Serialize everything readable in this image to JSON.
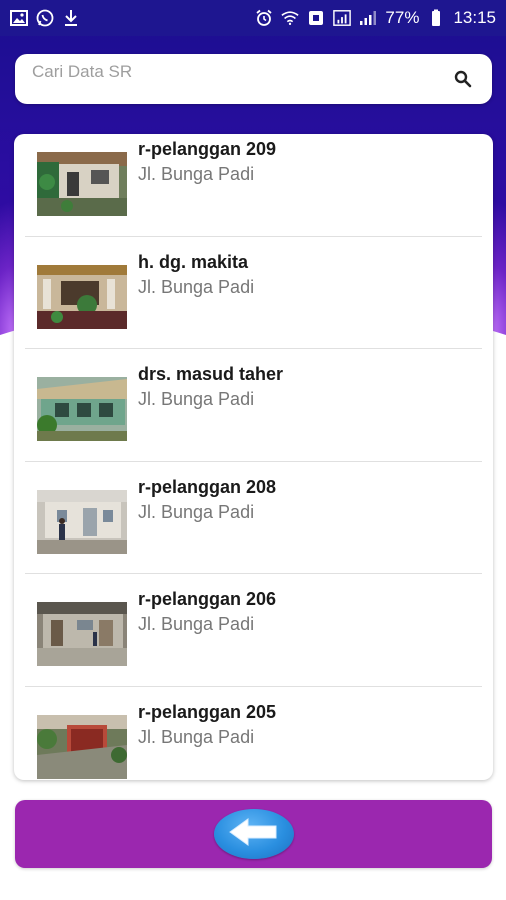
{
  "status_bar": {
    "battery": "77%",
    "time": "13:15"
  },
  "search": {
    "placeholder": "Cari Data SR",
    "value": ""
  },
  "list": {
    "items": [
      {
        "name": "r-pelanggan 209",
        "address": "Jl. Bunga Padi"
      },
      {
        "name": "h. dg. makita",
        "address": "Jl. Bunga Padi"
      },
      {
        "name": "drs. masud taher",
        "address": "Jl. Bunga Padi"
      },
      {
        "name": "r-pelanggan 208",
        "address": "Jl. Bunga Padi"
      },
      {
        "name": "r-pelanggan 206",
        "address": "Jl. Bunga Padi"
      },
      {
        "name": "r-pelanggan 205",
        "address": "Jl. Bunga Padi"
      }
    ]
  },
  "colors": {
    "status_bar": "#1e1690",
    "bottom_bar": "#9b27af",
    "back_button": "#2a8fe0"
  },
  "icons": {
    "back": "arrow-left-icon",
    "search": "search-icon"
  }
}
